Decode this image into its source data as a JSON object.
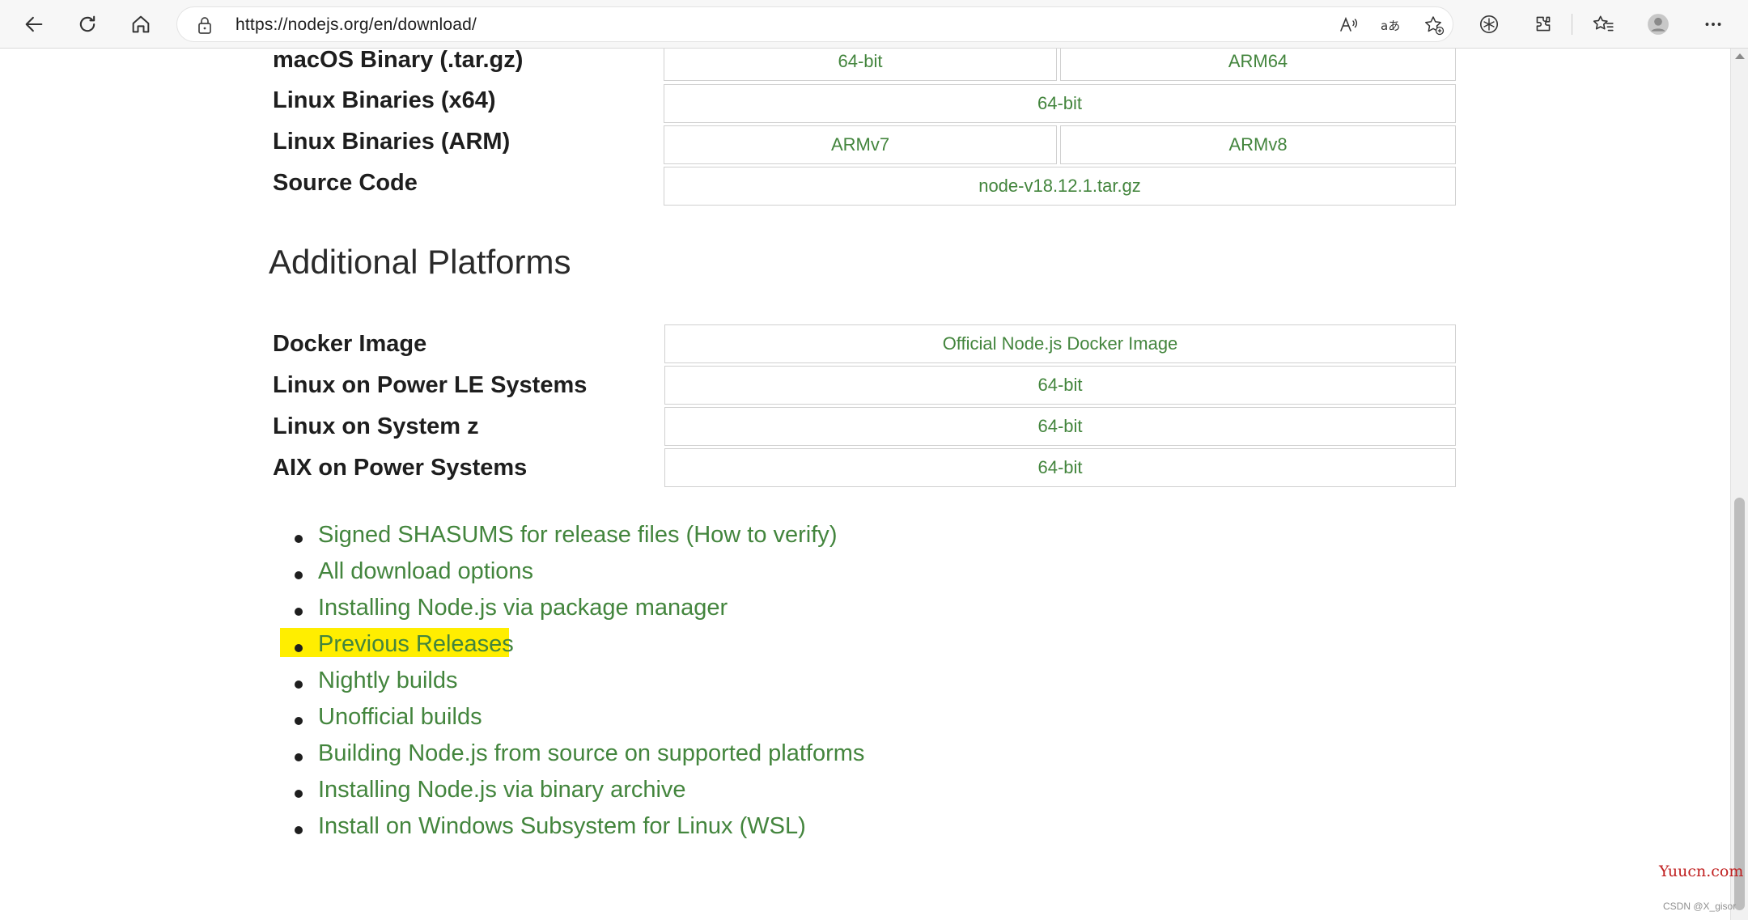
{
  "browser": {
    "url": "https://nodejs.org/en/download/",
    "icons": [
      "back-icon",
      "refresh-icon",
      "home-icon",
      "lock-icon",
      "read-aloud-icon",
      "translate-icon",
      "favorite-add-icon",
      "copilot-icon",
      "extensions-icon",
      "favorites-icon",
      "profile-icon",
      "more-icon"
    ]
  },
  "binaries": [
    {
      "label": "macOS Binary (.tar.gz)",
      "options": [
        "64-bit",
        "ARM64"
      ]
    },
    {
      "label": "Linux Binaries (x64)",
      "options": [
        "64-bit"
      ]
    },
    {
      "label": "Linux Binaries (ARM)",
      "options": [
        "ARMv7",
        "ARMv8"
      ]
    },
    {
      "label": "Source Code",
      "options": [
        "node-v18.12.1.tar.gz"
      ]
    }
  ],
  "additional": {
    "title": "Additional Platforms",
    "rows": [
      {
        "label": "Docker Image",
        "option": "Official Node.js Docker Image"
      },
      {
        "label": "Linux on Power LE Systems",
        "option": "64-bit"
      },
      {
        "label": "Linux on System z",
        "option": "64-bit"
      },
      {
        "label": "AIX on Power Systems",
        "option": "64-bit"
      }
    ]
  },
  "links": {
    "shasums": {
      "text": "Signed SHASUMS for release files",
      "paren_open": " (",
      "verify": "How to verify",
      "paren_close": ")"
    },
    "items": [
      "All download options",
      "Installing Node.js via package manager",
      "Previous Releases",
      "Nightly builds",
      "Unofficial builds",
      "Building Node.js from source on supported platforms",
      "Installing Node.js via binary archive",
      "Install on Windows Subsystem for Linux (WSL)"
    ],
    "highlighted": "Previous Releases",
    "highlight_color": "#ffee00"
  },
  "colors": {
    "link": "#43853d",
    "text": "#1e1e1e"
  },
  "watermark": {
    "site": "Yuucn.com",
    "credit": "CSDN @X_gisor"
  }
}
